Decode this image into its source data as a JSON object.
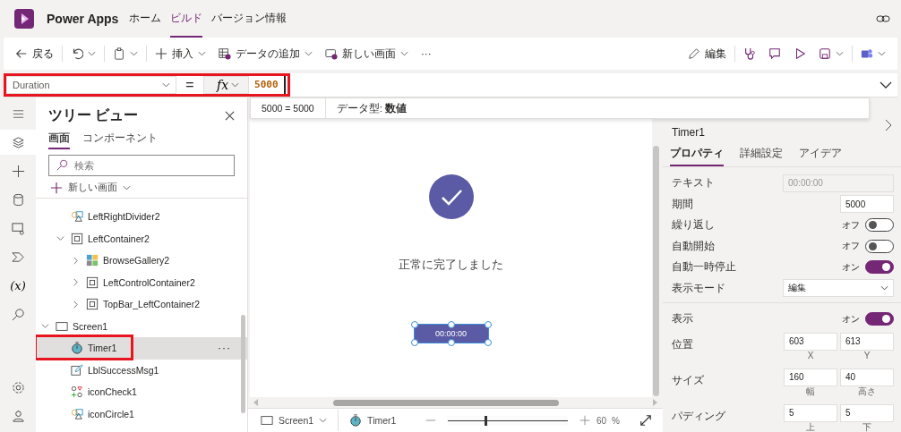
{
  "header": {
    "app_name": "Power Apps",
    "tabs": [
      {
        "label": "ホーム",
        "selected": false
      },
      {
        "label": "ビルド",
        "selected": true
      },
      {
        "label": "バージョン情報",
        "selected": false
      }
    ]
  },
  "toolbar": {
    "left": [
      {
        "kind": "back",
        "label": "戻る",
        "menu": false
      },
      {
        "kind": "undo",
        "menu": true
      },
      {
        "kind": "paste",
        "menu": true
      },
      {
        "kind": "insert",
        "label": "挿入",
        "menu": true
      },
      {
        "kind": "data",
        "label": "データの追加",
        "menu": true
      },
      {
        "kind": "screen",
        "label": "新しい画面",
        "menu": true
      },
      {
        "kind": "more",
        "label": "···",
        "menu": false
      }
    ],
    "right": [
      {
        "kind": "edit",
        "label": "編集",
        "menu": false
      },
      {
        "kind": "checker",
        "menu": false
      },
      {
        "kind": "comment",
        "menu": false
      },
      {
        "kind": "play",
        "menu": false
      },
      {
        "kind": "save",
        "menu": true
      },
      {
        "kind": "teams",
        "menu": true
      }
    ]
  },
  "formula_bar": {
    "property": "Duration",
    "highlighted": true,
    "equals": "=",
    "fx": "fx",
    "formula": "5000",
    "hint_result": "5000  =  5000",
    "hint_type": "データ型: **数値**"
  },
  "rail": [
    {
      "kind": "menu",
      "selected": false
    },
    {
      "kind": "layers",
      "selected": true
    },
    {
      "kind": "plus",
      "selected": false
    },
    {
      "kind": "data",
      "selected": false
    },
    {
      "kind": "media",
      "selected": false
    },
    {
      "kind": "flow",
      "selected": false
    },
    {
      "kind": "variables",
      "glyph": "(x)",
      "selected": false
    },
    {
      "kind": "search",
      "selected": false
    },
    {
      "kind": "settings",
      "selected": false
    },
    {
      "kind": "agent",
      "selected": false
    }
  ],
  "tree": {
    "title": "ツリー ビュー",
    "tabs": [
      {
        "label": "画面",
        "selected": true
      },
      {
        "label": "コンポーネント",
        "selected": false
      }
    ],
    "search": {
      "placeholder": "検索"
    },
    "new_screen": "新しい画面",
    "continued_items": [
      {
        "label": "LeftRightDivider2",
        "kind": "image",
        "selected": false
      },
      {
        "label": "LeftContainer2",
        "kind": "container",
        "expanded": true,
        "selected": false,
        "children": [
          {
            "label": "BrowseGallery2",
            "kind": "gallery",
            "expanded": false,
            "selected": false
          },
          {
            "label": "LeftControlContainer2",
            "kind": "container",
            "expanded": false,
            "selected": false
          },
          {
            "label": "TopBar_LeftContainer2",
            "kind": "container",
            "expanded": false,
            "selected": false
          }
        ]
      }
    ],
    "items": [
      {
        "label": "Screen1",
        "kind": "screen",
        "expanded": true,
        "selected": false,
        "children": [
          {
            "label": "Timer1",
            "kind": "timer",
            "selected": true,
            "highlighted": true,
            "more": "···"
          },
          {
            "label": "LblSuccessMsg1",
            "kind": "label",
            "selected": false
          },
          {
            "label": "iconCheck1",
            "kind": "icons",
            "selected": false
          },
          {
            "label": "iconCircle1",
            "kind": "image",
            "selected": false
          }
        ]
      }
    ]
  },
  "canvas": {
    "message": "正常に完了しました",
    "timer_label": "00:00:00",
    "timer_selected": true
  },
  "status_bar": {
    "screen": "Screen1",
    "control": "Timer1",
    "zoom": {
      "level": 0.32
    },
    "zoom_value": "60",
    "zoom_unit": "%"
  },
  "properties": {
    "control_name": "Timer1",
    "tabs": [
      {
        "label": "プロパティ",
        "selected": true
      },
      {
        "label": "詳細設定",
        "selected": false
      },
      {
        "label": "アイデア",
        "selected": false
      }
    ],
    "groups": [
      [
        {
          "kind": "text",
          "label": "テキスト",
          "value": "00:00:00",
          "disabled": true
        },
        {
          "kind": "number",
          "label": "期間",
          "value": "5000"
        },
        {
          "kind": "toggle",
          "label": "繰り返し",
          "state": "オフ",
          "on": false
        },
        {
          "kind": "toggle",
          "label": "自動開始",
          "state": "オフ",
          "on": false
        },
        {
          "kind": "toggle",
          "label": "自動一時停止",
          "state": "オン",
          "on": true
        },
        {
          "kind": "dropdown",
          "label": "表示モード",
          "value": "編集"
        }
      ],
      [
        {
          "kind": "toggle",
          "label": "表示",
          "state": "オン",
          "on": true
        },
        {
          "kind": "pair",
          "label": "位置",
          "values": [
            "603",
            "613"
          ],
          "captions": [
            "X",
            "Y"
          ]
        },
        {
          "kind": "pair",
          "label": "サイズ",
          "values": [
            "160",
            "40"
          ],
          "captions": [
            "幅",
            "高さ"
          ]
        },
        {
          "kind": "pair",
          "label": "パディング",
          "values": [
            "5",
            "5"
          ],
          "captions": [
            "上",
            "下"
          ]
        }
      ]
    ]
  }
}
